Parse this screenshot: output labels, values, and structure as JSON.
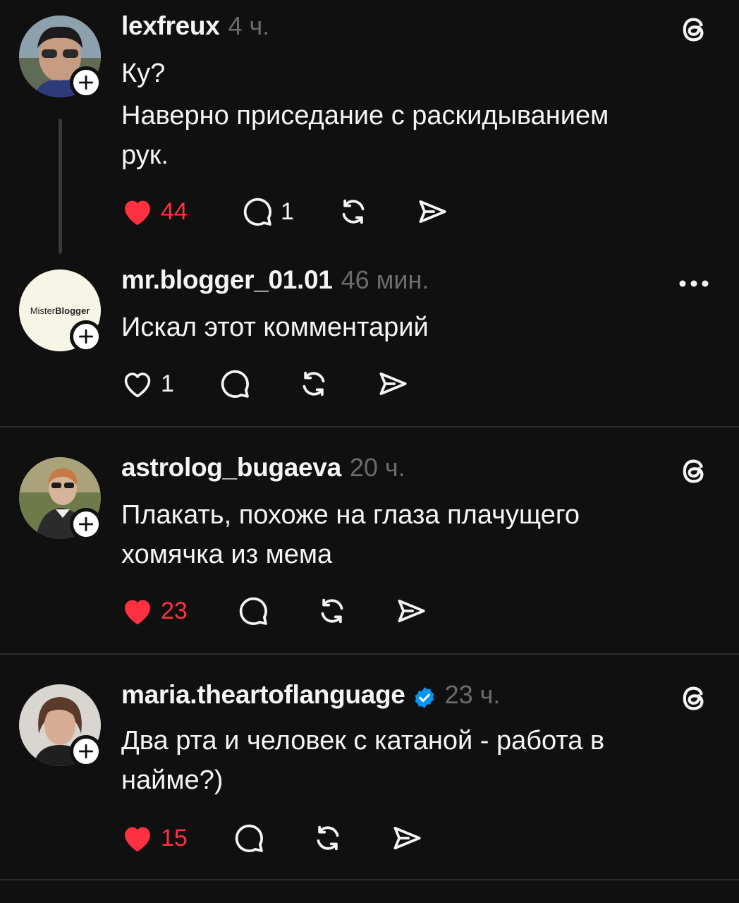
{
  "posts": [
    {
      "username": "lexfreux",
      "time": "4 ч.",
      "lines": [
        "Ку?",
        "Наверно приседание с раскидыванием",
        "рук."
      ],
      "likes": "44",
      "liked": true,
      "replies": "1",
      "corner_icon": "threads-icon"
    },
    {
      "username": "mr.blogger_01.01",
      "time": "46 мин.",
      "avatar_logo": {
        "part1": "Mister",
        "part2": "Blogger"
      },
      "lines": [
        "Искал этот комментарий"
      ],
      "likes": "1",
      "liked": false,
      "replies": "",
      "corner_icon": "more-icon"
    },
    {
      "username": "astrolog_bugaeva",
      "time": "20 ч.",
      "lines": [
        "Плакать, похоже на глаза плачущего",
        "хомячка из мема"
      ],
      "likes": "23",
      "liked": true,
      "replies": "",
      "corner_icon": "threads-icon"
    },
    {
      "username": "maria.theartoflanguage",
      "time": "23 ч.",
      "verified": true,
      "lines": [
        "Два рта и человек с катаной - работа в",
        "найме?)"
      ],
      "likes": "15",
      "liked": true,
      "replies": "",
      "corner_icon": "threads-icon"
    }
  ],
  "colors": {
    "background": "#101010",
    "like_red": "#ff3040",
    "muted": "#6b6b6b",
    "verified_blue": "#0095f6"
  }
}
